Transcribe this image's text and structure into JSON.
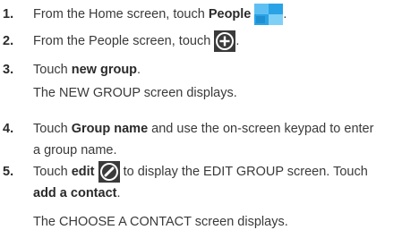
{
  "steps": [
    {
      "num": "1.",
      "before": "From the Home screen, touch ",
      "bold": "People",
      "after": ".",
      "icon": "people-tile-icon"
    },
    {
      "num": "2.",
      "before": "From the People screen, touch ",
      "after": ".",
      "icon": "add-circle-icon"
    },
    {
      "num": "3.",
      "before": "Touch ",
      "bold": "new group",
      "after": ".",
      "note": "The NEW GROUP screen displays."
    },
    {
      "num": "4.",
      "before": "Touch ",
      "bold": "Group name",
      "after": " and use the on-screen keypad to enter",
      "cont": "a group name."
    },
    {
      "num": "5.",
      "before": "Touch ",
      "bold": "edit",
      "after": " to display the EDIT GROUP screen. Touch",
      "cont_bold": "add a contact",
      "cont_after": ".",
      "note": "The CHOOSE A CONTACT screen displays.",
      "icon": "edit-pencil-icon"
    }
  ],
  "colors": {
    "text": "#3a3a3a",
    "people_tile": "#2aa3e6",
    "icon_dark": "#3a3a3a"
  }
}
